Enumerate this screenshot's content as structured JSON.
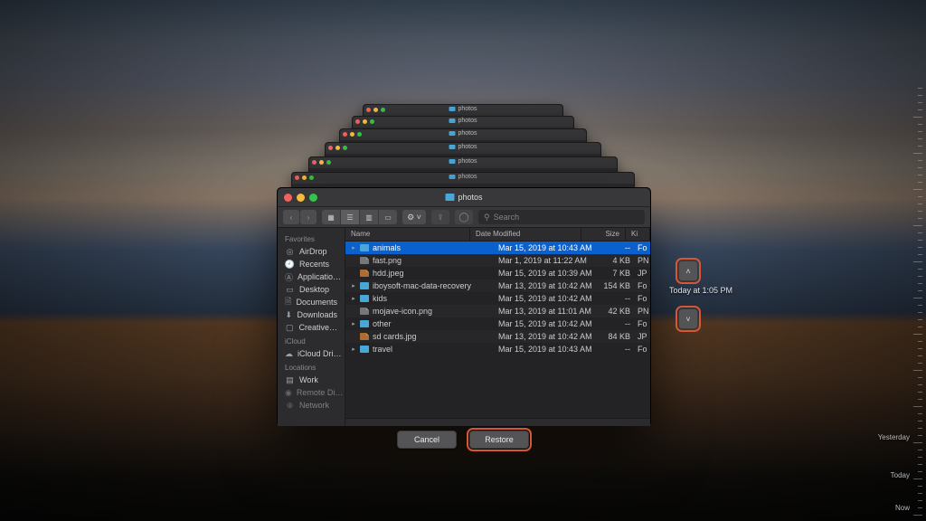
{
  "window": {
    "title": "photos"
  },
  "toolbar": {
    "search_placeholder": "Search",
    "gear_label": "⚙ ˅"
  },
  "sidebar": {
    "sections": {
      "favorites": "Favorites",
      "icloud": "iCloud",
      "locations": "Locations"
    },
    "items": [
      {
        "icon": "airdrop",
        "label": "AirDrop"
      },
      {
        "icon": "recents",
        "label": "Recents"
      },
      {
        "icon": "apps",
        "label": "Applicatio…"
      },
      {
        "icon": "desktop",
        "label": "Desktop"
      },
      {
        "icon": "documents",
        "label": "Documents"
      },
      {
        "icon": "downloads",
        "label": "Downloads"
      },
      {
        "icon": "creative",
        "label": "Creative…"
      }
    ],
    "icloud": [
      {
        "icon": "icloud",
        "label": "iCloud Dri…"
      }
    ],
    "locations": [
      {
        "icon": "work",
        "label": "Work"
      },
      {
        "icon": "remote",
        "label": "Remote Di…"
      },
      {
        "icon": "network",
        "label": "Network"
      }
    ]
  },
  "columns": {
    "name": "Name",
    "date": "Date Modified",
    "size": "Size",
    "kind": "Ki"
  },
  "rows": [
    {
      "sel": true,
      "disc": "▸",
      "type": "folder",
      "name": "animals",
      "date": "Mar 15, 2019 at 10:43 AM",
      "size": "--",
      "kind": "Fo"
    },
    {
      "sel": false,
      "disc": "",
      "type": "png",
      "name": "fast.png",
      "date": "Mar 1, 2019 at 11:22 AM",
      "size": "4 KB",
      "kind": "PN"
    },
    {
      "sel": false,
      "disc": "",
      "type": "jpg",
      "name": "hdd.jpeg",
      "date": "Mar 15, 2019 at 10:39 AM",
      "size": "7 KB",
      "kind": "JP"
    },
    {
      "sel": false,
      "disc": "▸",
      "type": "folder",
      "name": "iboysoft-mac-data-recovery",
      "date": "Mar 13, 2019 at 10:42 AM",
      "size": "154 KB",
      "kind": "Fo"
    },
    {
      "sel": false,
      "disc": "▸",
      "type": "folder",
      "name": "kids",
      "date": "Mar 15, 2019 at 10:42 AM",
      "size": "--",
      "kind": "Fo"
    },
    {
      "sel": false,
      "disc": "",
      "type": "png",
      "name": "mojave-icon.png",
      "date": "Mar 13, 2019 at 11:01 AM",
      "size": "42 KB",
      "kind": "PN"
    },
    {
      "sel": false,
      "disc": "▸",
      "type": "folder",
      "name": "other",
      "date": "Mar 15, 2019 at 10:42 AM",
      "size": "--",
      "kind": "Fo"
    },
    {
      "sel": false,
      "disc": "",
      "type": "jpg",
      "name": "sd cards.jpg",
      "date": "Mar 13, 2019 at 10:42 AM",
      "size": "84 KB",
      "kind": "JP"
    },
    {
      "sel": false,
      "disc": "▸",
      "type": "folder",
      "name": "travel",
      "date": "Mar 15, 2019 at 10:43 AM",
      "size": "--",
      "kind": "Fo"
    }
  ],
  "buttons": {
    "cancel": "Cancel",
    "restore": "Restore"
  },
  "snapshot": {
    "current": "Today at 1:05 PM"
  },
  "timeline": {
    "yesterday": "Yesterday",
    "today": "Today",
    "now": "Now"
  }
}
